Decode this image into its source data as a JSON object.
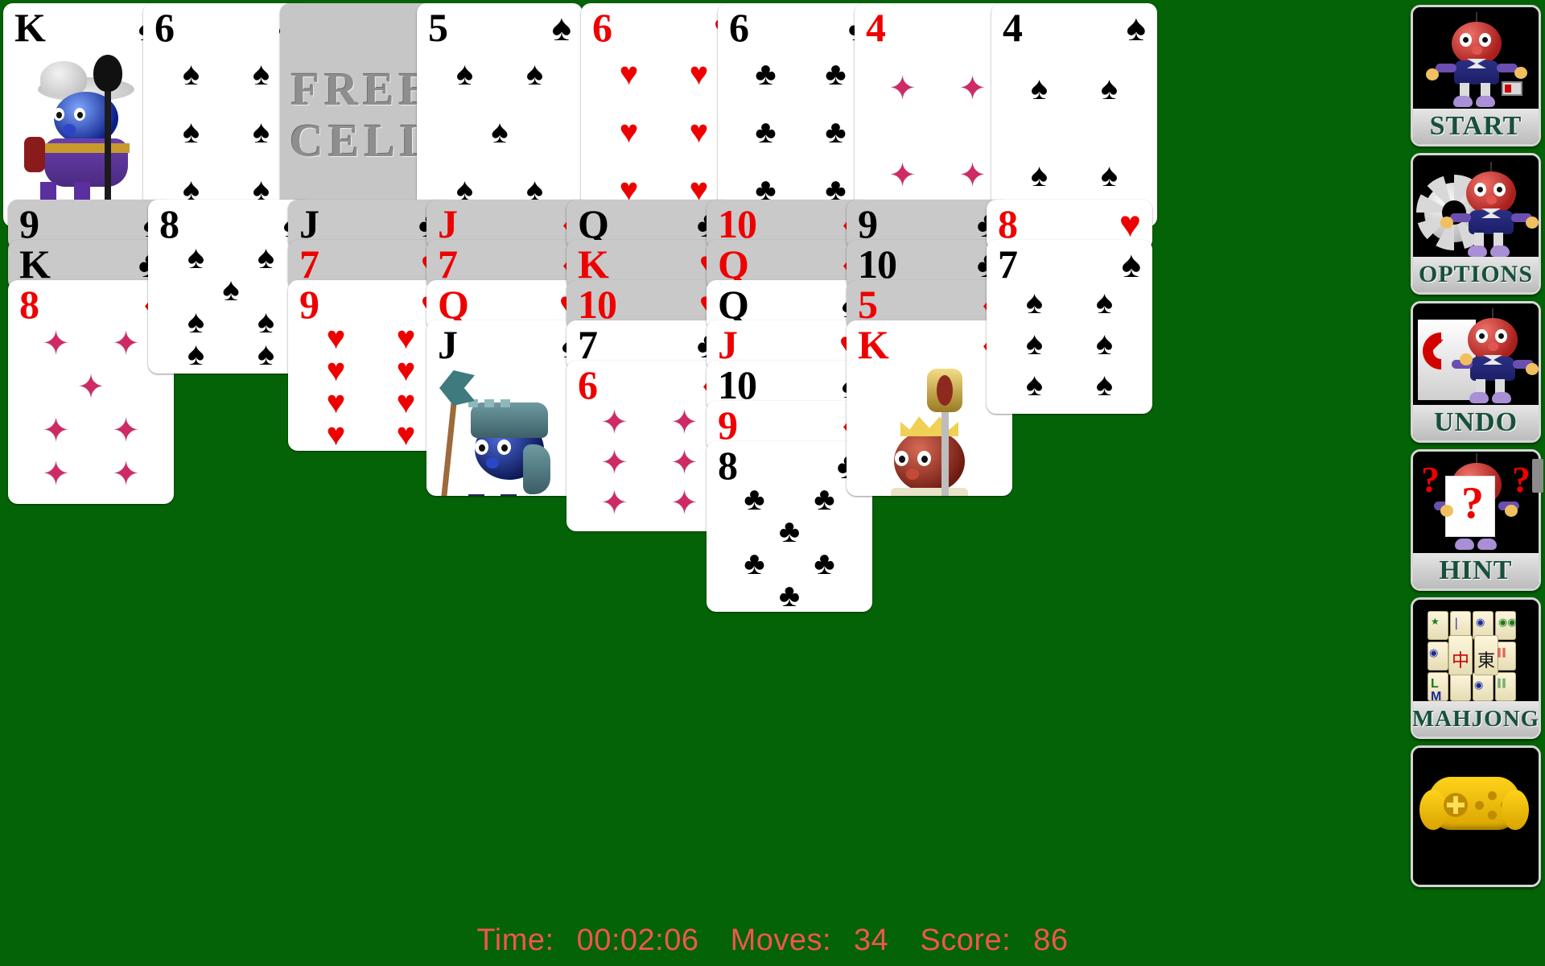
{
  "app": {
    "logo_line1": "FREE",
    "logo_line2": "CELL",
    "table_color": "#046306"
  },
  "free_cells": [
    {
      "slot": 1,
      "empty": false,
      "rank": "K",
      "suit": "♠",
      "color": "black",
      "face": "king-spades",
      "label": "K of Spades"
    },
    {
      "slot": 2,
      "empty": false,
      "rank": "6",
      "suit": "♠",
      "color": "black",
      "face": "",
      "label": "6 of Spades"
    },
    {
      "slot": 3,
      "empty": true,
      "rank": "",
      "suit": "",
      "color": "",
      "face": "",
      "label": "empty free cell"
    },
    {
      "slot": 4,
      "empty": false,
      "rank": "5",
      "suit": "♠",
      "color": "black",
      "face": "",
      "label": "5 of Spades"
    }
  ],
  "foundations": [
    {
      "slot": 1,
      "rank": "6",
      "suit": "♥",
      "color": "red",
      "label": "6 of Hearts"
    },
    {
      "slot": 2,
      "rank": "6",
      "suit": "♣",
      "color": "black",
      "label": "6 of Clubs"
    },
    {
      "slot": 3,
      "rank": "4",
      "suit": "♦",
      "color": "red",
      "label": "4 of Diamonds"
    },
    {
      "slot": 4,
      "rank": "4",
      "suit": "♠",
      "color": "black",
      "label": "4 of Spades"
    }
  ],
  "tableau": [
    {
      "column": 1,
      "cards": [
        {
          "rank": "9",
          "suit": "♠",
          "color": "black",
          "dim": true,
          "label": "9 of Spades"
        },
        {
          "rank": "K",
          "suit": "♣",
          "color": "black",
          "dim": true,
          "label": "K of Clubs"
        },
        {
          "rank": "8",
          "suit": "♦",
          "color": "red",
          "dim": false,
          "label": "8 of Diamonds"
        }
      ]
    },
    {
      "column": 2,
      "cards": [
        {
          "rank": "8",
          "suit": "♠",
          "color": "black",
          "dim": false,
          "label": "8 of Spades"
        }
      ]
    },
    {
      "column": 3,
      "cards": [
        {
          "rank": "J",
          "suit": "♣",
          "color": "black",
          "dim": true,
          "label": "J of Clubs"
        },
        {
          "rank": "7",
          "suit": "♥",
          "color": "red",
          "dim": true,
          "label": "7 of Hearts"
        },
        {
          "rank": "9",
          "suit": "♥",
          "color": "red",
          "dim": false,
          "label": "9 of Hearts"
        }
      ]
    },
    {
      "column": 4,
      "cards": [
        {
          "rank": "J",
          "suit": "♦",
          "color": "red",
          "dim": true,
          "label": "J of Diamonds"
        },
        {
          "rank": "7",
          "suit": "♦",
          "color": "red",
          "dim": true,
          "label": "7 of Diamonds"
        },
        {
          "rank": "Q",
          "suit": "♥",
          "color": "red",
          "dim": false,
          "label": "Q of Hearts"
        },
        {
          "rank": "J",
          "suit": "♠",
          "color": "black",
          "dim": false,
          "label": "J of Spades"
        }
      ]
    },
    {
      "column": 5,
      "cards": [
        {
          "rank": "Q",
          "suit": "♣",
          "color": "black",
          "dim": true,
          "label": "Q of Clubs"
        },
        {
          "rank": "K",
          "suit": "♥",
          "color": "red",
          "dim": true,
          "label": "K of Hearts"
        },
        {
          "rank": "10",
          "suit": "♥",
          "color": "red",
          "dim": true,
          "label": "10 of Hearts"
        },
        {
          "rank": "7",
          "suit": "♣",
          "color": "black",
          "dim": false,
          "label": "7 of Clubs"
        },
        {
          "rank": "6",
          "suit": "♦",
          "color": "red",
          "dim": false,
          "label": "6 of Diamonds"
        }
      ]
    },
    {
      "column": 6,
      "cards": [
        {
          "rank": "10",
          "suit": "♦",
          "color": "red",
          "dim": true,
          "label": "10 of Diamonds"
        },
        {
          "rank": "Q",
          "suit": "♦",
          "color": "red",
          "dim": true,
          "label": "Q of Diamonds"
        },
        {
          "rank": "Q",
          "suit": "♠",
          "color": "black",
          "dim": false,
          "label": "Q of Spades"
        },
        {
          "rank": "J",
          "suit": "♥",
          "color": "red",
          "dim": false,
          "label": "J of Hearts"
        },
        {
          "rank": "10",
          "suit": "♠",
          "color": "black",
          "dim": false,
          "label": "10 of Spades"
        },
        {
          "rank": "9",
          "suit": "♦",
          "color": "red",
          "dim": false,
          "label": "9 of Diamonds"
        },
        {
          "rank": "8",
          "suit": "♣",
          "color": "black",
          "dim": false,
          "label": "8 of Clubs"
        }
      ]
    },
    {
      "column": 7,
      "cards": [
        {
          "rank": "9",
          "suit": "♣",
          "color": "black",
          "dim": true,
          "label": "9 of Clubs"
        },
        {
          "rank": "10",
          "suit": "♣",
          "color": "black",
          "dim": true,
          "label": "10 of Clubs"
        },
        {
          "rank": "5",
          "suit": "♦",
          "color": "red",
          "dim": true,
          "label": "5 of Diamonds"
        },
        {
          "rank": "K",
          "suit": "♦",
          "color": "red",
          "dim": false,
          "label": "K of Diamonds"
        }
      ]
    },
    {
      "column": 8,
      "cards": [
        {
          "rank": "8",
          "suit": "♥",
          "color": "red",
          "dim": false,
          "label": "8 of Hearts"
        },
        {
          "rank": "7",
          "suit": "♠",
          "color": "black",
          "dim": false,
          "label": "7 of Spades"
        }
      ]
    }
  ],
  "sidebar": {
    "buttons": [
      {
        "id": "start",
        "label": "START",
        "icon": "mascot-start-icon"
      },
      {
        "id": "options",
        "label": "OPTIONS",
        "icon": "gear-mascot-icon"
      },
      {
        "id": "undo",
        "label": "UNDO",
        "icon": "undo-arrow-icon"
      },
      {
        "id": "hint",
        "label": "HINT",
        "icon": "question-mark-icon"
      },
      {
        "id": "mahjong",
        "label": "MAHJONG",
        "icon": "mahjong-tiles-icon"
      },
      {
        "id": "more-games",
        "label": "",
        "icon": "gamepad-icon"
      }
    ]
  },
  "status": {
    "time_label": "Time:",
    "time_value": "00:02:06",
    "moves_label": "Moves:",
    "moves_value": "34",
    "score_label": "Score:",
    "score_value": "86",
    "color": "#f0564d"
  }
}
